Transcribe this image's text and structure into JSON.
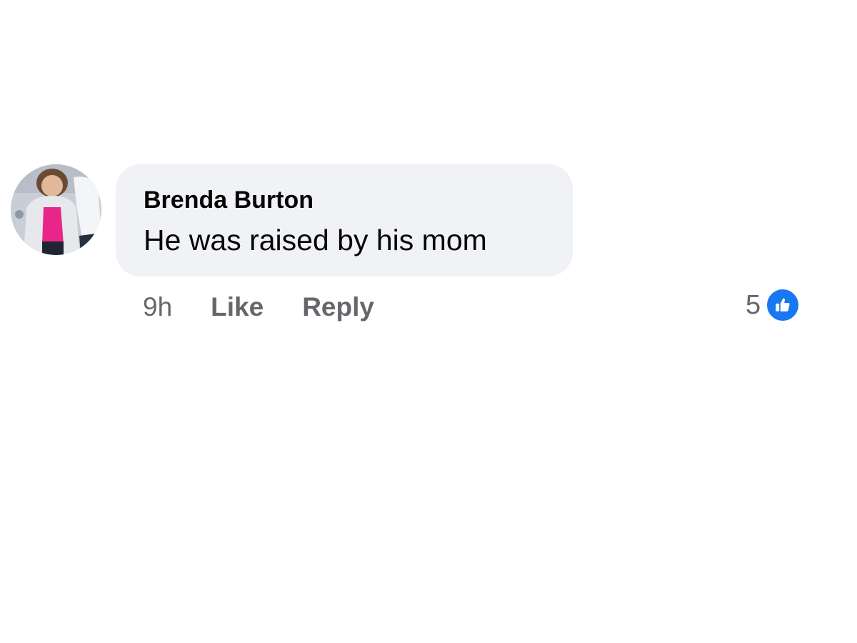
{
  "comment": {
    "author": "Brenda Burton",
    "text": "He was raised by his mom",
    "timestamp": "9h",
    "like_label": "Like",
    "reply_label": "Reply",
    "reaction_count": "5",
    "reaction_icon": "like-thumbs-up-icon",
    "colors": {
      "bubble_background": "#f0f2f5",
      "like_badge": "#1877f2",
      "secondary_text": "#65676b"
    }
  }
}
